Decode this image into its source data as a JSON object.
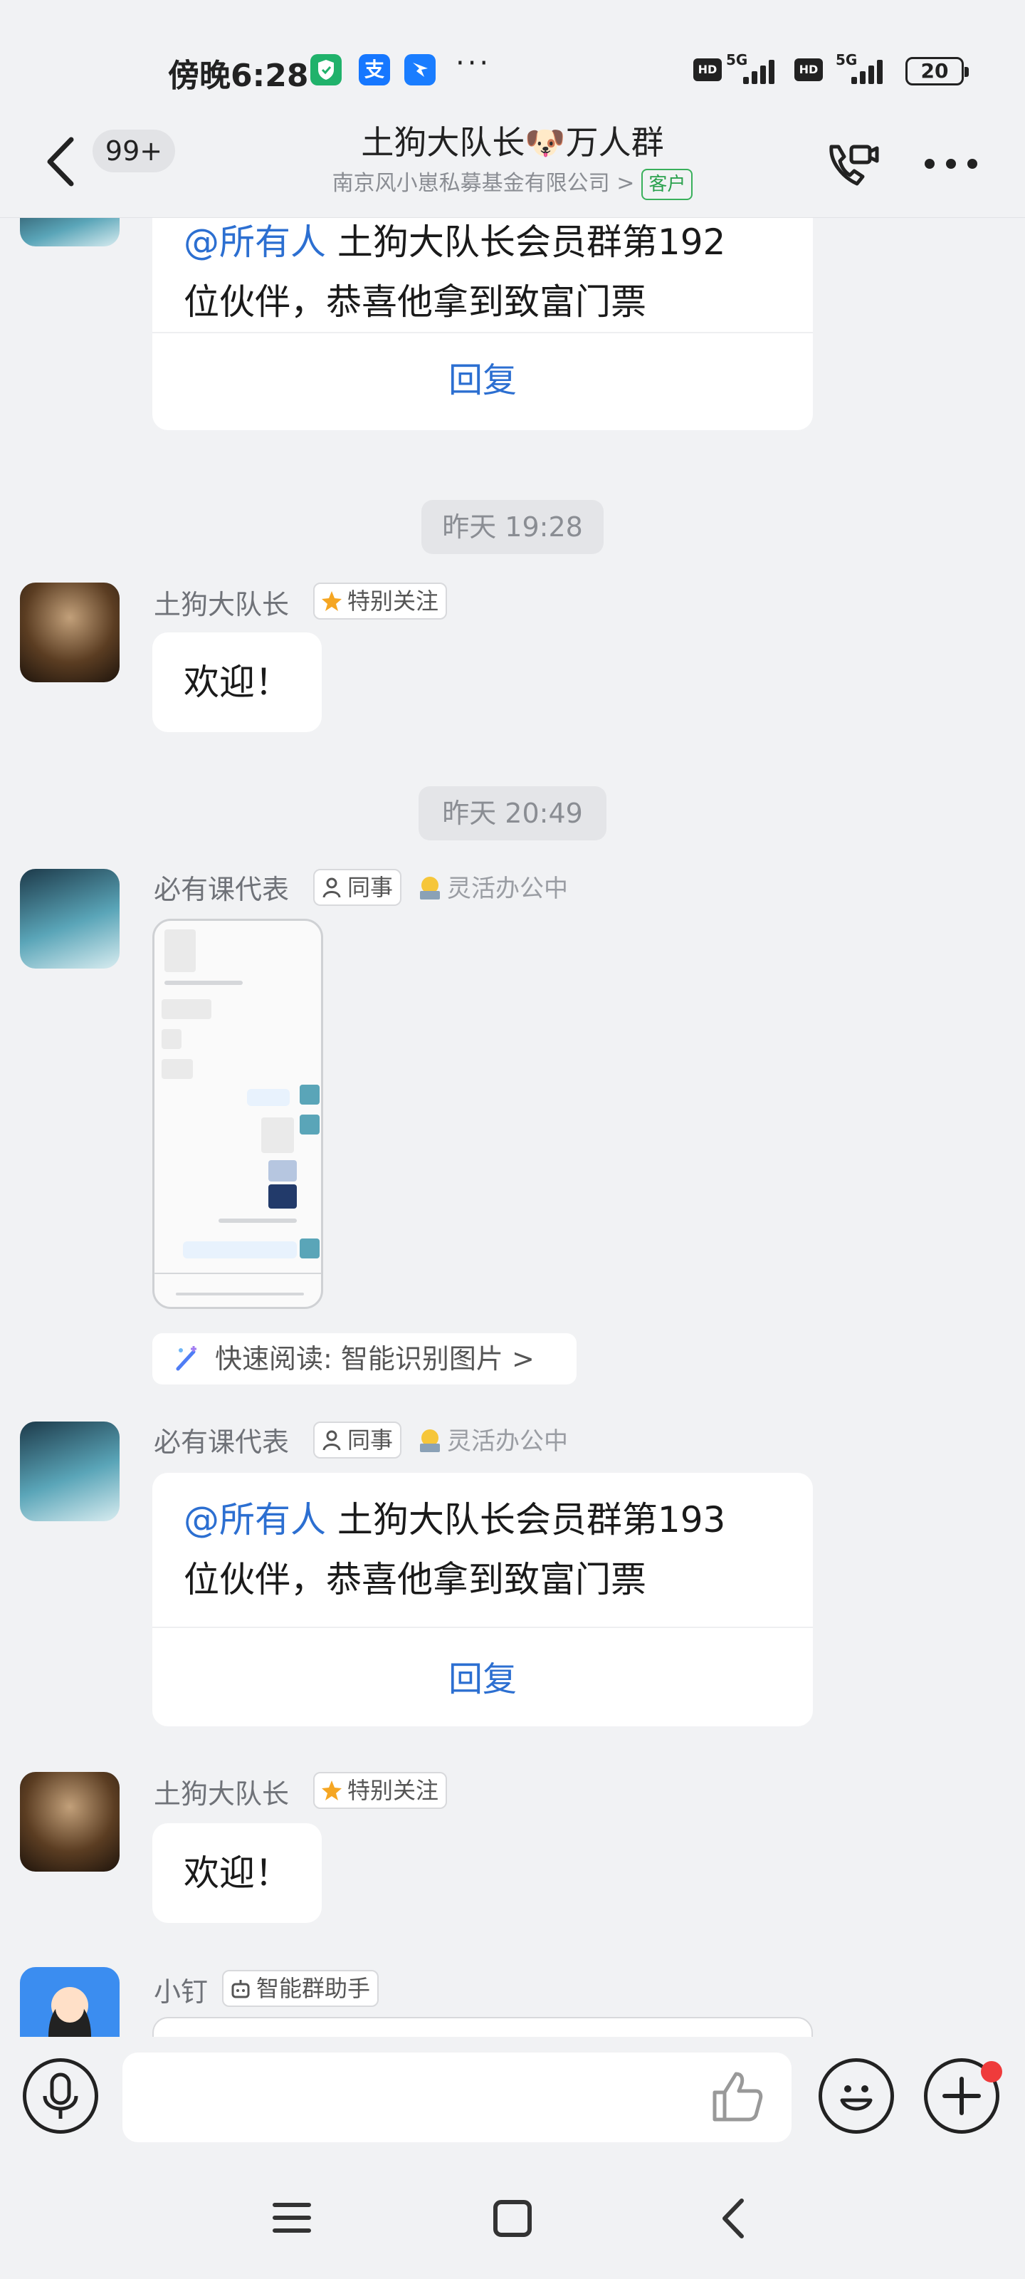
{
  "status_bar": {
    "time": "傍晚6:28",
    "app_icon_2": "支",
    "more": "···",
    "net1_hd": "HD",
    "net1_gen": "5G",
    "net2_hd": "HD",
    "net2_gen": "5G",
    "battery": "20"
  },
  "header": {
    "unread_count": "99+",
    "title": "土狗大队长🐶万人群",
    "company": "南京风小崽私募基金有限公司",
    "company_chevron": ">",
    "customer_tag": "客户"
  },
  "messages": [
    {
      "type": "announcement",
      "mention": "@所有人",
      "line1": "土狗大队长会员群第192",
      "line2": "位伙伴，恭喜他拿到致富门票",
      "reply": "回复"
    },
    {
      "type": "time",
      "text": "昨天 19:28"
    },
    {
      "type": "text",
      "sender": "土狗大队长",
      "tag": "特别关注",
      "text": "欢迎！"
    },
    {
      "type": "time",
      "text": "昨天 20:49"
    },
    {
      "type": "image",
      "sender": "必有课代表",
      "tag": "同事",
      "status": "灵活办公中",
      "quick_read": "快速阅读: 智能识别图片 >"
    },
    {
      "type": "announcement",
      "sender": "必有课代表",
      "tag": "同事",
      "status": "灵活办公中",
      "mention": "@所有人",
      "line1": "土狗大队长会员群第193",
      "line2": "位伙伴，恭喜他拿到致富门票",
      "reply": "回复"
    },
    {
      "type": "text",
      "sender": "土狗大队长",
      "tag": "特别关注",
      "text": "欢迎！"
    },
    {
      "type": "partial",
      "sender": "小钉",
      "tag": "智能群助手"
    }
  ],
  "icons": {
    "back": "chevron-left",
    "call": "phone-video",
    "more": "ellipsis",
    "voice": "microphone",
    "like": "thumbs-up",
    "emoji": "smiley",
    "plus": "plus",
    "nav_menu": "menu-lines",
    "nav_home": "square",
    "nav_back": "triangle-left"
  },
  "colors": {
    "accent": "#2c6fd1",
    "customer_tag": "#2aa14d",
    "badge_red": "#ef3b3b",
    "star": "#f5a623"
  }
}
